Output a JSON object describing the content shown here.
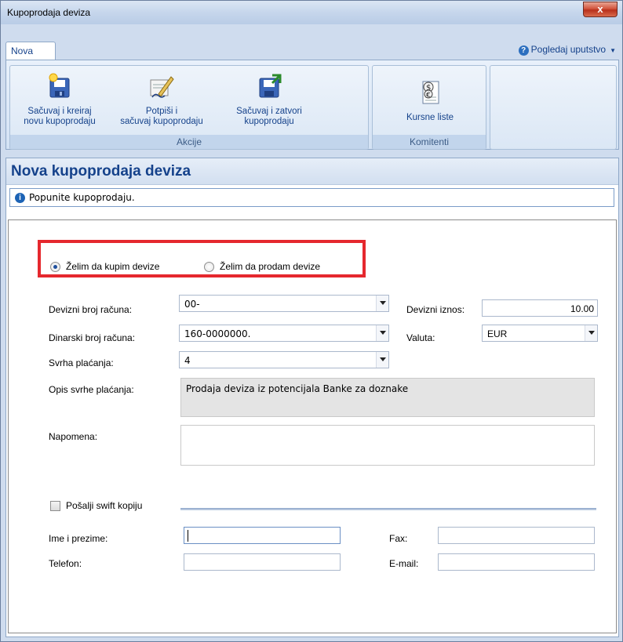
{
  "window": {
    "title": "Kupoprodaja deviza",
    "close_label": "x"
  },
  "ribbon": {
    "tab": "Nova",
    "help_label": "Pogledaj uputstvo",
    "groups": [
      {
        "label": "Akcije",
        "buttons": [
          {
            "line1": "Sačuvaj i kreiraj",
            "line2": "novu kupoprodaju",
            "icon": "save-new-icon"
          },
          {
            "line1": "Potpiši i",
            "line2": "sačuvaj kupoprodaju",
            "icon": "sign-icon"
          },
          {
            "line1": "Sačuvaj i zatvori",
            "line2": "kupoprodaju",
            "icon": "save-close-icon"
          }
        ]
      },
      {
        "label": "Komitenti",
        "buttons": [
          {
            "line1": "Kursne liste",
            "icon": "exchange-rate-icon"
          }
        ]
      }
    ]
  },
  "page": {
    "title": "Nova kupoprodaja deviza",
    "info": "Popunite kupoprodaju."
  },
  "form": {
    "radio_buy": "Želim da kupim devize",
    "radio_sell": "Želim da prodam devize",
    "selected": "buy",
    "fields": {
      "devizni_racun_label": "Devizni broj računa:",
      "devizni_racun_value": "00-",
      "dinarski_racun_label": "Dinarski broj računa:",
      "dinarski_racun_value": "160-0000000.",
      "svrha_label": "Svrha plaćanja:",
      "svrha_value": "4",
      "opis_label": "Opis svrhe plaćanja:",
      "opis_value": "Prodaja deviza iz potencijala Banke za doznake",
      "napomena_label": "Napomena:",
      "iznos_label": "Devizni iznos:",
      "iznos_value": "10.00",
      "valuta_label": "Valuta:",
      "valuta_value": "EUR"
    },
    "swift": {
      "checkbox_label": "Pošalji swift kopiju",
      "ime_label": "Ime i prezime:",
      "telefon_label": "Telefon:",
      "fax_label": "Fax:",
      "email_label": "E-mail:"
    }
  },
  "colors": {
    "highlight": "#e5282e",
    "accent": "#15428b"
  }
}
